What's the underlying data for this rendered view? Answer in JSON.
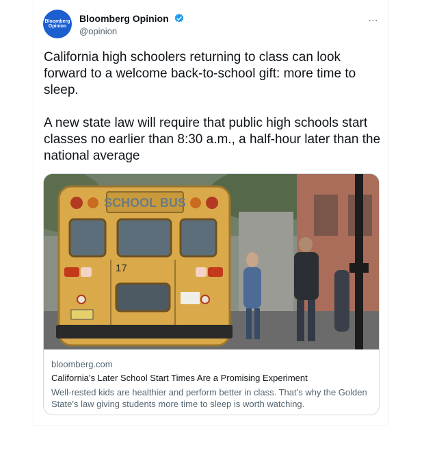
{
  "author": {
    "avatar_line1": "Bloomberg",
    "avatar_line2": "Opinion",
    "name": "Bloomberg Opinion",
    "handle": "@opinion"
  },
  "more_icon": "…",
  "tweet": {
    "paragraph1": "California high schoolers returning to class can look forward to a welcome back-to-school gift: more time to sleep.",
    "paragraph2": "A new state law will require that public high schools start classes no earlier than 8:30 a.m., a half-hour later than the national average"
  },
  "link_card": {
    "bus_sign": "SCHOOL BUS",
    "bus_number": "17",
    "domain": "bloomberg.com",
    "title": "California’s Later School Start Times Are a Promising Experiment",
    "description": "Well-rested kids are healthier and perform better in class. That’s why the Golden State's law giving students more time to sleep is worth watching."
  },
  "colors": {
    "verified": "#1d9bf0",
    "avatar_bg": "#1d5fd1",
    "bus_yellow": "#d9a94a"
  },
  "icons": [
    "verified-badge-icon",
    "more-options-icon"
  ]
}
